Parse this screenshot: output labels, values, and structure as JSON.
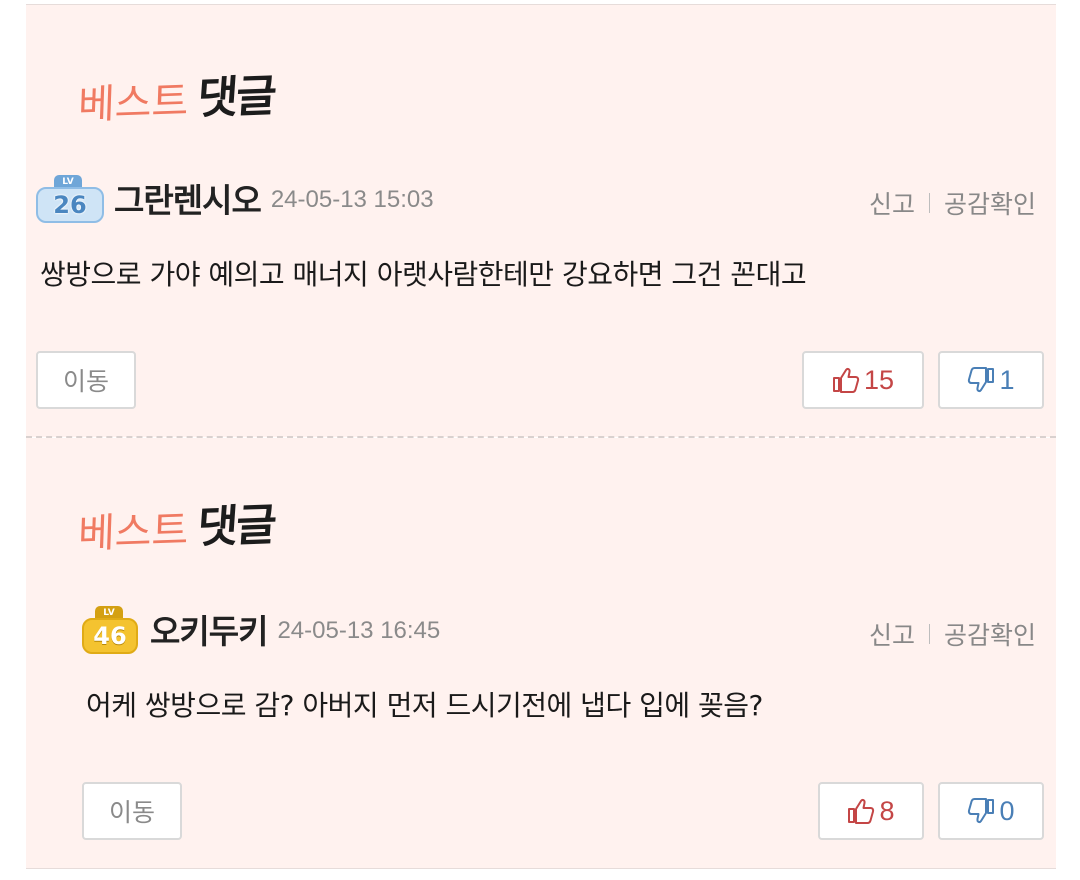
{
  "best_logo": {
    "red_text": "베스트",
    "black_text": "댓글"
  },
  "comments": [
    {
      "level": "26",
      "level_label": "LV",
      "username": "그란렌시오",
      "timestamp": "24-05-13 15:03",
      "report_label": "신고",
      "empathy_label": "공감확인",
      "text": "쌍방으로 가야 예의고 매너지 아랫사람한테만 강요하면 그건 꼰대고",
      "move_label": "이동",
      "upvotes": "15",
      "downvotes": "1"
    },
    {
      "level": "46",
      "level_label": "LV",
      "username": "오키두키",
      "timestamp": "24-05-13 16:45",
      "report_label": "신고",
      "empathy_label": "공감확인",
      "text": "어케 쌍방으로 감? 아버지 먼저 드시기전에 냅다 입에 꽂음?",
      "move_label": "이동",
      "upvotes": "8",
      "downvotes": "0"
    }
  ],
  "colors": {
    "panel_bg": "#fff2ef",
    "upvote": "#c44646",
    "downvote": "#4a7fb6",
    "badge_blue": "#cfe4f6",
    "badge_gold": "#f4c330"
  },
  "icons": {
    "upvote": "thumbs-up-icon",
    "downvote": "thumbs-down-icon"
  }
}
